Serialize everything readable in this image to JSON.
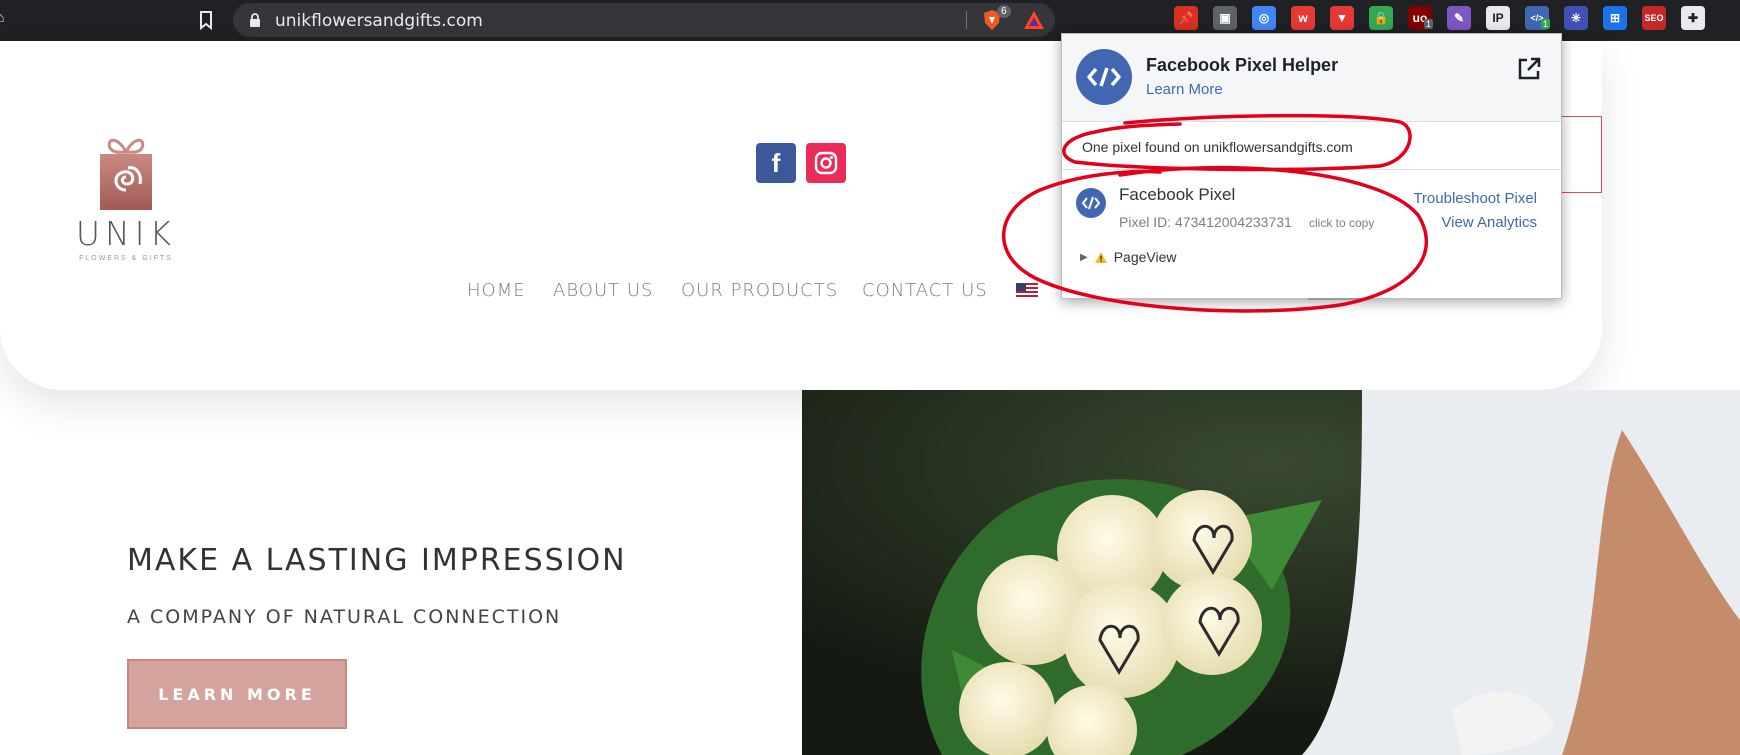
{
  "browser": {
    "url": "unikflowersandgifts.com",
    "brave_shield_count": "6",
    "extensions": [
      {
        "name": "pin-extension",
        "color": "#d93025",
        "glyph": "📌"
      },
      {
        "name": "window-extension",
        "color": "#5f6368",
        "glyph": "▣"
      },
      {
        "name": "colorzilla-extension",
        "color": "#4285f4",
        "glyph": "◎"
      },
      {
        "name": "wappalyzer-extension",
        "color": "#e53935",
        "glyph": "w"
      },
      {
        "name": "shield-extension",
        "color": "#e53935",
        "glyph": "▼"
      },
      {
        "name": "lock-extension",
        "color": "#34a853",
        "glyph": "🔒"
      },
      {
        "name": "ublock-extension",
        "color": "#800000",
        "glyph": "uo",
        "badge": "1"
      },
      {
        "name": "feather-extension",
        "color": "#7e57c2",
        "glyph": "✎"
      },
      {
        "name": "ip-extension",
        "color": "#e8eaed",
        "glyph": "IP"
      },
      {
        "name": "pixel-helper-extension",
        "color": "#4267b2",
        "glyph": "</>",
        "badge": "1"
      },
      {
        "name": "snowflake-extension",
        "color": "#3f51b5",
        "glyph": "✳"
      },
      {
        "name": "tab-extension",
        "color": "#1a73e8",
        "glyph": "⊞"
      },
      {
        "name": "seo-extension",
        "color": "#c62828",
        "glyph": "SEO"
      },
      {
        "name": "puzzle-extension",
        "color": "#e8eaed",
        "glyph": "✚"
      }
    ]
  },
  "site": {
    "brand": "UNIK",
    "tagline": "FLOWERS & GIFTS",
    "social": {
      "facebook_glyph": "f"
    },
    "nav": [
      "HOME",
      "ABOUT US",
      "OUR PRODUCTS",
      "CONTACT US"
    ],
    "hero": {
      "title": "MAKE A LASTING IMPRESSION",
      "subtitle": "A COMPANY OF NATURAL CONNECTION",
      "button": "LEARN MORE"
    }
  },
  "pixel_helper": {
    "title": "Facebook Pixel Helper",
    "learn_more": "Learn More",
    "found_text": "One pixel found on unikflowersandgifts.com",
    "pixel_name": "Facebook Pixel",
    "pixel_id": "Pixel ID: 473412004233731",
    "copy_hint": "click to copy",
    "troubleshoot": "Troubleshoot Pixel",
    "analytics": "View Analytics",
    "event": "PageView"
  },
  "colors": {
    "facebook_blue": "#4267b2",
    "annotation_red": "#e4001b",
    "button_pink": "#d4a39e"
  }
}
